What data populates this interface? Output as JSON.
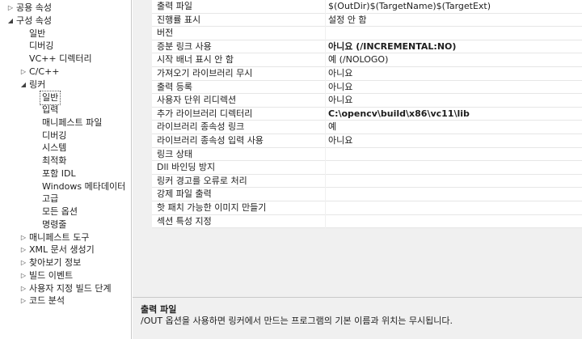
{
  "tree": [
    {
      "label": "공용 속성",
      "arrow": "▷"
    },
    {
      "label": "구성 속성",
      "arrow": "◢"
    },
    {
      "label": "일반",
      "arrow": ""
    },
    {
      "label": "디버깅",
      "arrow": ""
    },
    {
      "label": "VC++ 디렉터리",
      "arrow": ""
    },
    {
      "label": "C/C++",
      "arrow": "▷"
    },
    {
      "label": "링커",
      "arrow": "◢"
    },
    {
      "label": "일반",
      "arrow": ""
    },
    {
      "label": "입력",
      "arrow": ""
    },
    {
      "label": "매니페스트 파일",
      "arrow": ""
    },
    {
      "label": "디버깅",
      "arrow": ""
    },
    {
      "label": "시스템",
      "arrow": ""
    },
    {
      "label": "최적화",
      "arrow": ""
    },
    {
      "label": "포함 IDL",
      "arrow": ""
    },
    {
      "label": "Windows 메타데이터",
      "arrow": ""
    },
    {
      "label": "고급",
      "arrow": ""
    },
    {
      "label": "모든 옵션",
      "arrow": ""
    },
    {
      "label": "명령줄",
      "arrow": ""
    },
    {
      "label": "매니페스트 도구",
      "arrow": "▷"
    },
    {
      "label": "XML 문서 생성기",
      "arrow": "▷"
    },
    {
      "label": "찾아보기 정보",
      "arrow": "▷"
    },
    {
      "label": "빌드 이벤트",
      "arrow": "▷"
    },
    {
      "label": "사용자 지정 빌드 단계",
      "arrow": "▷"
    },
    {
      "label": "코드 분석",
      "arrow": "▷"
    }
  ],
  "properties": [
    {
      "name": "출력 파일",
      "value": "$(OutDir)$(TargetName)$(TargetExt)",
      "bold": false
    },
    {
      "name": "진행률 표시",
      "value": "설정 안 함",
      "bold": false
    },
    {
      "name": "버전",
      "value": "",
      "bold": false
    },
    {
      "name": "증분 링크 사용",
      "value": "아니요 (/INCREMENTAL:NO)",
      "bold": true
    },
    {
      "name": "시작 배너 표시 안 함",
      "value": "예 (/NOLOGO)",
      "bold": false
    },
    {
      "name": "가져오기 라이브러리 무시",
      "value": "아니요",
      "bold": false
    },
    {
      "name": "출력 등록",
      "value": "아니요",
      "bold": false
    },
    {
      "name": "사용자 단위 리디렉션",
      "value": "아니요",
      "bold": false
    },
    {
      "name": "추가 라이브러리 디렉터리",
      "value": "C:\\opencv\\build\\x86\\vc11\\lib",
      "bold": true
    },
    {
      "name": "라이브러리 종속성 링크",
      "value": "예",
      "bold": false
    },
    {
      "name": "라이브러리 종속성 입력 사용",
      "value": "아니요",
      "bold": false
    },
    {
      "name": "링크 상태",
      "value": "",
      "bold": false
    },
    {
      "name": "Dll 바인딩 방지",
      "value": "",
      "bold": false
    },
    {
      "name": "링커 경고를 오류로 처리",
      "value": "",
      "bold": false
    },
    {
      "name": "강제 파일 출력",
      "value": "",
      "bold": false
    },
    {
      "name": "핫 패치 가능한 이미지 만들기",
      "value": "",
      "bold": false
    },
    {
      "name": "섹션 특성 지정",
      "value": "",
      "bold": false
    }
  ],
  "description": {
    "title": "출력 파일",
    "text": "/OUT 옵션을 사용하면 링커에서 만드는 프로그램의 기본 이름과 위치는 무시됩니다."
  }
}
